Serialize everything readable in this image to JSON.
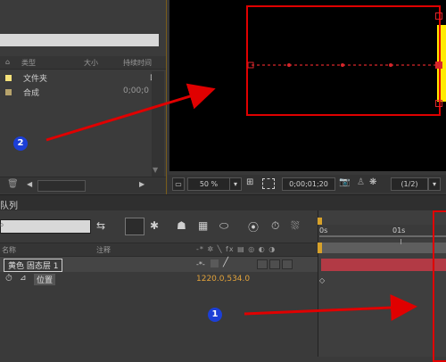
{
  "project": {
    "columns": {
      "type": "类型",
      "size": "大小",
      "duration": "持续时间"
    },
    "items": [
      {
        "name": "文件夹",
        "swatch": "#f5e27a"
      },
      {
        "name": "合成",
        "swatch": "#b7a36c",
        "duration": "0;00;0"
      }
    ]
  },
  "viewer": {
    "zoom": "50 %",
    "timecode": "0;00;01;20",
    "resolution": "(1/2)"
  },
  "timeline": {
    "tab_label": "队列",
    "col_name": "名称",
    "col_comment": "注释",
    "layer_name": "黄色 固态层 1",
    "property_name": "位置",
    "property_value": "1220.0,534.0",
    "ruler_start": "0s",
    "ruler_01": "01s"
  },
  "annotations": {
    "one": "1",
    "two": "2"
  },
  "colors": {
    "accent_red": "#e00000",
    "layer_bar": "#b23a45",
    "yellow": "#ffea00",
    "value_orange": "#e1a23a",
    "badge_blue": "#1c3fd6"
  }
}
